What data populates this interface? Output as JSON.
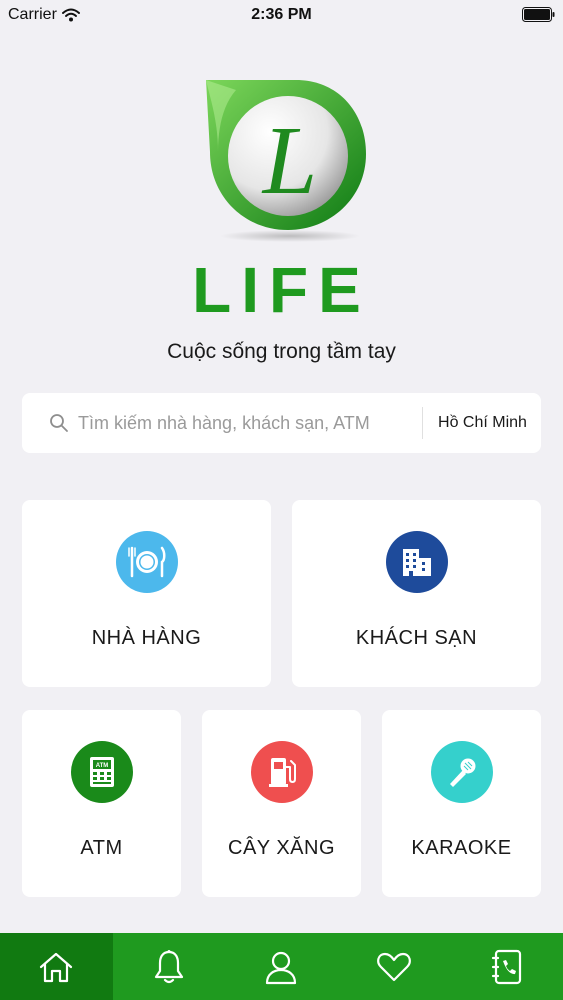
{
  "status_bar": {
    "carrier": "Carrier",
    "time": "2:36 PM",
    "wifi_icon": "wifi-icon",
    "battery_icon": "battery-full-icon"
  },
  "brand": {
    "name": "LIFE",
    "logo_letter": "L",
    "tagline": "Cuộc sống trong tầm tay",
    "color": "#1f9a1f"
  },
  "search": {
    "icon": "search-icon",
    "placeholder": "Tìm kiếm nhà hàng, khách sạn, ATM",
    "city": "Hồ Chí Minh"
  },
  "categories": [
    {
      "label": "NHÀ HÀNG",
      "icon": "plate-cutlery-icon",
      "color": "#4cb8ec"
    },
    {
      "label": "KHÁCH SẠN",
      "icon": "building-icon",
      "color": "#1e4b9b"
    },
    {
      "label": "ATM",
      "icon": "atm-icon",
      "color": "#1a8a1a"
    },
    {
      "label": "CÂY XĂNG",
      "icon": "fuel-pump-icon",
      "color": "#ef4f4f"
    },
    {
      "label": "KARAOKE",
      "icon": "microphone-icon",
      "color": "#35d0cc"
    }
  ],
  "tab_bar": {
    "background": "#1f9a1f",
    "active_background": "#117a11",
    "tabs": [
      {
        "icon": "home-icon",
        "active": true
      },
      {
        "icon": "bell-icon",
        "active": false
      },
      {
        "icon": "user-icon",
        "active": false
      },
      {
        "icon": "heart-icon",
        "active": false
      },
      {
        "icon": "contact-book-icon",
        "active": false
      }
    ]
  }
}
